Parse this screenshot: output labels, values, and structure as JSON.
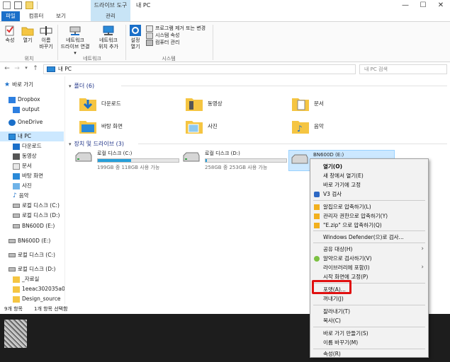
{
  "window": {
    "context_tab": "드라이브 도구",
    "title": "내 PC",
    "minimize": "—",
    "maximize": "☐",
    "close": "✕"
  },
  "tabs": {
    "file": "파일",
    "computer": "컴퓨터",
    "view": "보기",
    "manage": "관리"
  },
  "ribbon": {
    "properties": "속성",
    "open": "열기",
    "rename_line1": "이름",
    "rename_line2": "바꾸기",
    "location_group": "위치",
    "access_media_line1": "미디어",
    "access_media_line2": "액세스",
    "map_drive_line1": "네트워크",
    "map_drive_line2": "드라이브 연결 ▾",
    "add_location_line1": "네트워크",
    "add_location_line2": "위치 추가",
    "network_group": "네트워크",
    "settings_line1": "설정",
    "settings_line2": "열기",
    "uninstall": "프로그램 제거 또는 변경",
    "system_props": "시스템 속성",
    "manage": "컴퓨터 관리",
    "system_group": "시스템"
  },
  "address": {
    "back": "←",
    "forward": "→",
    "recent": "▾",
    "up": "↑",
    "path": "내 PC",
    "search_placeholder": "내 PC 검색"
  },
  "sidebar": {
    "items": [
      {
        "label": "바로 가기"
      },
      {
        "label": "Dropbox"
      },
      {
        "label": "output"
      },
      {
        "label": "OneDrive"
      },
      {
        "label": "내 PC"
      },
      {
        "label": "다운로드"
      },
      {
        "label": "동영상"
      },
      {
        "label": "문서"
      },
      {
        "label": "바탕 화면"
      },
      {
        "label": "사진"
      },
      {
        "label": "음악"
      },
      {
        "label": "로컬 디스크 (C:)"
      },
      {
        "label": "로컬 디스크 (D:)"
      },
      {
        "label": "BN600D (E:)"
      },
      {
        "label": "BN600D (E:)"
      },
      {
        "label": "로컬 디스크 (C:)"
      },
      {
        "label": "로컬 디스크 (D:)"
      },
      {
        "label": "_자료실"
      },
      {
        "label": "1eeac302035a0"
      },
      {
        "label": "Design_source"
      }
    ]
  },
  "content": {
    "folders_header": "폴더 (6)",
    "drives_header": "장치 및 드라이브 (3)",
    "folders": [
      {
        "label": "다운로드"
      },
      {
        "label": "동영상"
      },
      {
        "label": "문서"
      },
      {
        "label": "바탕 화면"
      },
      {
        "label": "사진"
      },
      {
        "label": "음악"
      }
    ],
    "drives": [
      {
        "label": "로컬 디스크 (C:)",
        "space": "199GB 중 118GB 사용 가능",
        "used_fraction": 0.41
      },
      {
        "label": "로컬 디스크 (D:)",
        "space": "258GB 중 253GB 사용 가능",
        "used_fraction": 0.02
      },
      {
        "label": "BN600D (E:)"
      }
    ]
  },
  "status": {
    "count": "9개 항목",
    "selected": "1개 항목 선택함"
  },
  "context_menu": {
    "items": [
      "열기(O)",
      "새 창에서 열기(E)",
      "바로 가기에 고정",
      "V3 검사",
      "알집으로 압축하기(L)",
      "관리자 권한으로 압축하기(Y)",
      "\"E.zip\" 으로 압축하기(Q)",
      "Windows Defender(으)로 검사...",
      "공유 대상(H)",
      "알약으로 검사하기(V)",
      "라이브러리에 포함(I)",
      "시작 화면에 고정(P)",
      "포맷(A)...",
      "꺼내기(J)",
      "잘라내기(T)",
      "복사(C)",
      "바로 가기 만들기(S)",
      "이름 바꾸기(M)",
      "속성(R)"
    ]
  },
  "colors": {
    "accent": "#1a6fc9",
    "selection": "#cce8ff",
    "highlight_box": "#e01010"
  }
}
